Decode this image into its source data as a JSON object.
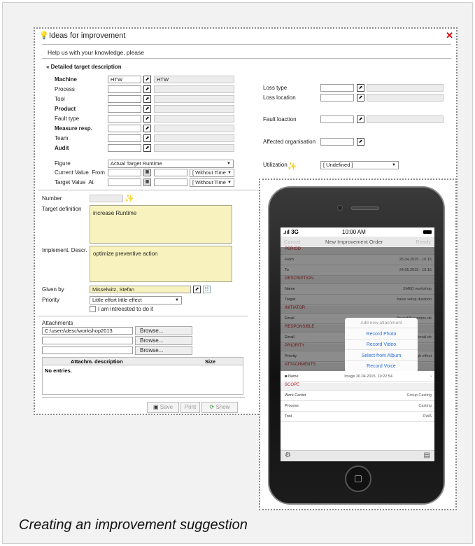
{
  "window": {
    "title": "Ideas for improvement",
    "subtitle": "Help us with your knowledge, please",
    "section": "Detailed target description",
    "left_fields": [
      {
        "label": "Machine",
        "bold": true,
        "value": "HTW",
        "readonly": "HTW"
      },
      {
        "label": "Process",
        "bold": false,
        "value": "",
        "readonly": ""
      },
      {
        "label": "Tool",
        "bold": false,
        "value": "",
        "readonly": ""
      },
      {
        "label": "Product",
        "bold": true,
        "value": "",
        "readonly": ""
      },
      {
        "label": "Fault type",
        "bold": false,
        "value": "",
        "readonly": ""
      },
      {
        "label": "Measure resp.",
        "bold": true,
        "value": "",
        "readonly": ""
      },
      {
        "label": "Team",
        "bold": false,
        "value": "",
        "readonly": ""
      },
      {
        "label": "Audit",
        "bold": true,
        "value": "",
        "readonly": ""
      }
    ],
    "figure_label": "Figure",
    "figure_value": "Actual Target Runtime",
    "current_value_label": "Current Value",
    "from_label": "From",
    "target_value_label": "Target Value",
    "at_label": "At",
    "time_select": "[ Without Time",
    "right_fields": {
      "loss_type": "Loss type",
      "loss_location": "Loss location",
      "fault_location": "Fault loaction",
      "affected_org": "Affected organisation",
      "utilization_label": "Utilization",
      "utilization_value": "[ Undefined ]"
    },
    "number_label": "Number",
    "target_definition_label": "Target definition",
    "target_definition_value": "increase Runtime",
    "implement_label": "Implement. Descr.",
    "implement_value": "optimize preventive action",
    "given_by_label": "Given by",
    "given_by_value": "Misselwitz, Stefan",
    "priority_label": "Priority",
    "priority_value": "Little effort little effect",
    "interest_label": "I am intreested to do it",
    "attachments_label": "Attachments",
    "attachment_path": "C:\\users\\desc\\workshop2013",
    "browse_label": "Browse...",
    "attach_col1": "Attachm. description",
    "attach_col2": "Size",
    "no_entries": "No entries.",
    "save_label": "Save",
    "print_label": "Print",
    "show_label": "Show"
  },
  "phone": {
    "carrier": ".ııl 3G",
    "time": "10:00 AM",
    "nav_cancel": "Cancel",
    "nav_title": "New Improvement Order",
    "nav_ready": "Ready",
    "period": "PERIOD",
    "from_k": "From",
    "from_v": "26.04.2015 - 10:15",
    "to_k": "To",
    "to_v": "24.05.2015 - 10:15",
    "description": "DESCRIPTION",
    "name_k": "Name",
    "name_v": "SMED workshop",
    "target_k": "Target",
    "target_v": "halve setup duration",
    "initiator": "INITIATOR",
    "email_k": "Email",
    "email_v": "lbrand@cosmino.de",
    "responsible": "RESPONSIBLE",
    "email2_v": "address@mail.de",
    "priority": "PRIORITY",
    "priority_k": "Priority",
    "priority_v": "nd / High effect",
    "attachments": "ATTACHMENTS",
    "att_name_k": "Name",
    "att_name_v": "Image 26.04.2015, 10:22:54",
    "scope": "SCOPE",
    "wc_k": "Work Center",
    "wc_v": "Group Casting",
    "proc_k": "Process",
    "proc_v": "Casting",
    "tool_k": "Tool",
    "tool_v": "DWA",
    "popup": [
      "Add new attachment",
      "Record Photo",
      "Record Video",
      "Select from Album",
      "Record Voice"
    ]
  },
  "caption": "Creating an improvement suggestion"
}
